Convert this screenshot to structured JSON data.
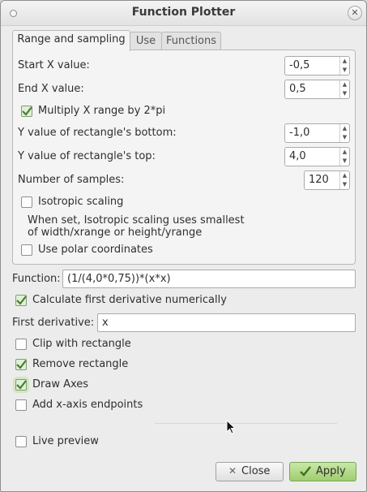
{
  "window": {
    "title": "Function Plotter"
  },
  "tabs": [
    "Range and sampling",
    "Use",
    "Functions"
  ],
  "range": {
    "start_x_label": "Start X value:",
    "start_x_value": "-0,5",
    "end_x_label": "End X value:",
    "end_x_value": "0,5",
    "multiply_label": "Multiply X range by 2*pi",
    "multiply_checked": true,
    "y_bottom_label": "Y value of rectangle's bottom:",
    "y_bottom_value": "-1,0",
    "y_top_label": "Y value of rectangle's top:",
    "y_top_value": "4,0",
    "samples_label": "Number of samples:",
    "samples_value": "120",
    "isotropic_label": "Isotropic scaling",
    "isotropic_checked": false,
    "isotropic_help_line1": "When set, Isotropic scaling uses smallest",
    "isotropic_help_line2": "of width/xrange or height/yrange",
    "polar_label": "Use polar coordinates",
    "polar_checked": false
  },
  "function": {
    "label": "Function:",
    "value": "(1/(4,0*0,75))*(x*x)"
  },
  "derivative": {
    "calc_label": "Calculate first derivative numerically",
    "calc_checked": true,
    "label": "First derivative:",
    "value": "x"
  },
  "options": {
    "clip_label": "Clip with rectangle",
    "clip_checked": false,
    "remove_label": "Remove rectangle",
    "remove_checked": true,
    "axes_label": "Draw Axes",
    "axes_checked": true,
    "endpoints_label": "Add x-axis endpoints",
    "endpoints_checked": false,
    "live_label": "Live preview",
    "live_checked": false
  },
  "buttons": {
    "close_label": "Close",
    "apply_label": "Apply"
  },
  "colors": {
    "accent_green": "#9fcd70",
    "check_mark": "#4e7a2f"
  }
}
